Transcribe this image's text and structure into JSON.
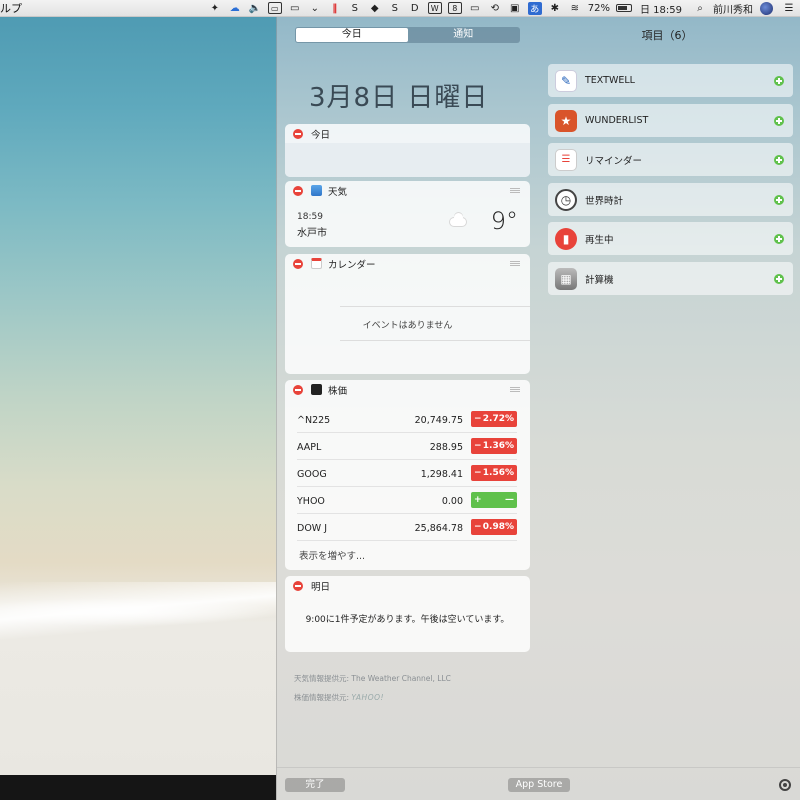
{
  "menubar": {
    "app_menu_fragment": "ルプ",
    "battery_percent": "72%",
    "clock": "日 18:59",
    "user_name": "前川秀和",
    "ime": "あ"
  },
  "panel": {
    "tabs": [
      "今日",
      "通知"
    ],
    "items_count_label": "項目（6）",
    "date_heading": "3月8日 日曜日"
  },
  "widgets": {
    "today": {
      "title": "今日"
    },
    "weather": {
      "title": "天気",
      "time": "18:59",
      "city": "水戸市",
      "temperature": "9°"
    },
    "calendar": {
      "title": "カレンダー",
      "empty_text": "イベントはありません"
    },
    "stocks": {
      "title": "株価",
      "rows": [
        {
          "symbol": "^N225",
          "price": "20,749.75",
          "sign": "−",
          "change": "2.72%",
          "status": "down"
        },
        {
          "symbol": "AAPL",
          "price": "288.95",
          "sign": "−",
          "change": "1.36%",
          "status": "down"
        },
        {
          "symbol": "GOOG",
          "price": "1,298.41",
          "sign": "−",
          "change": "1.56%",
          "status": "down"
        },
        {
          "symbol": "YHOO",
          "price": "0.00",
          "sign": "+",
          "change": "—",
          "status": "flat"
        },
        {
          "symbol": "DOW J",
          "price": "25,864.78",
          "sign": "−",
          "change": "0.98%",
          "status": "down"
        }
      ],
      "more_label": "表示を増やす..."
    },
    "tomorrow": {
      "title": "明日",
      "summary": "9:00に1件予定があります。午後は空いています。"
    }
  },
  "credits": {
    "weather_label": "天気情報提供元:",
    "weather_provider": "The Weather Channel, LLC",
    "stock_label": "株価情報提供元:",
    "stock_provider": "YAHOO!"
  },
  "available_items": [
    {
      "label": "TEXTWELL",
      "icon": "textwell-icon",
      "color": "#1e5fb8"
    },
    {
      "label": "WUNDERLIST",
      "icon": "wunderlist-icon",
      "color": "#d9542a"
    },
    {
      "label": "リマインダー",
      "icon": "reminders-icon",
      "color": "#ffffff"
    },
    {
      "label": "世界時計",
      "icon": "world-clock-icon",
      "color": "#ffffff"
    },
    {
      "label": "再生中",
      "icon": "now-playing-icon",
      "color": "#e8433a"
    },
    {
      "label": "計算機",
      "icon": "calculator-icon",
      "color": "#9a9a9a"
    }
  ],
  "bottom": {
    "done_label": "完了",
    "appstore_label": "App Store"
  }
}
